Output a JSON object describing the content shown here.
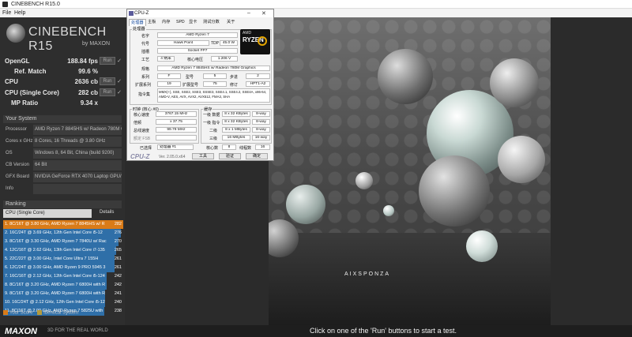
{
  "window": {
    "title": "CINEBENCH R15.0"
  },
  "menu": {
    "file": "File",
    "help": "Help"
  },
  "logo": {
    "name": "CINEBENCH R15",
    "sub": "by MAXON"
  },
  "results": [
    {
      "label": "OpenGL",
      "value": "188.84 fps",
      "run": "Run"
    },
    {
      "label": "Ref. Match",
      "value": "99.6 %",
      "run": ""
    },
    {
      "label": "CPU",
      "value": "2636 cb",
      "run": "Run"
    },
    {
      "label": "CPU (Single Core)",
      "value": "282 cb",
      "run": "Run"
    },
    {
      "label": "MP Ratio",
      "value": "9.34 x",
      "run": ""
    }
  ],
  "system": {
    "header": "Your System",
    "rows": [
      {
        "key": "Processor",
        "value": "AMD Ryzen 7 8845HS w/ Radeon 780M Graphi"
      },
      {
        "key": "Cores x GHz",
        "value": "8 Cores, 16 Threads @ 3.80 GHz"
      },
      {
        "key": "OS",
        "value": "Windows 8, 64 Bit, China (build 9200)"
      },
      {
        "key": "CB Version",
        "value": "64 Bit"
      },
      {
        "key": "GFX Board",
        "value": "NVIDIA GeForce RTX 4070 Laptop GPU/PCIe/"
      },
      {
        "key": "Info",
        "value": ""
      }
    ]
  },
  "ranking": {
    "header": "Ranking",
    "dropdown": "CPU (Single Core)",
    "details": "Details",
    "rows": [
      {
        "text": "1. 8C/16T @ 3.80 GHz, AMD Ryzen 7 8845HS w/ R",
        "score": "282",
        "fill": 1.0,
        "mine": true
      },
      {
        "text": "2. 16C/24T @ 3.69 GHz, 12th Gen Intel Core i5-12",
        "score": "276",
        "fill": 0.98,
        "mine": false
      },
      {
        "text": "3. 8C/16T @ 3.30 GHz, AMD Ryzen 7 7840U w/ Rac",
        "score": "270",
        "fill": 0.96,
        "mine": false
      },
      {
        "text": "4. 12C/16T @ 2.62 GHz, 13th Gen Intel Core i7-135",
        "score": "265",
        "fill": 0.94,
        "mine": false
      },
      {
        "text": "5. 22C/22T @ 3.00 GHz, Intel Core Ultra 7 155H",
        "score": "261",
        "fill": 0.93,
        "mine": false
      },
      {
        "text": "6. 12C/24T @ 3.00 GHz, AMD Ryzen 9 PRO 5945 3",
        "score": "261",
        "fill": 0.93,
        "mine": false
      },
      {
        "text": "7. 16C/16T @ 2.12 GHz, 12th Gen Intel Core i5-124",
        "score": "242",
        "fill": 0.86,
        "mine": false
      },
      {
        "text": "8. 8C/16T @ 3.20 GHz, AMD Ryzen 7 6800H with R",
        "score": "242",
        "fill": 0.86,
        "mine": false
      },
      {
        "text": "9. 8C/16T @ 3.20 GHz, AMD Ryzen 7 6800H with R",
        "score": "241",
        "fill": 0.85,
        "mine": false
      },
      {
        "text": "10. 16C/24T @ 2.12 GHz, 12th Gen Intel Core i5-12",
        "score": "240",
        "fill": 0.85,
        "mine": false
      },
      {
        "text": "11. 8C/16T @ 2.00 GHz, AMD Ryzen 7 5825U with",
        "score": "238",
        "fill": 0.84,
        "mine": false
      }
    ],
    "legend_mine": "Your Score",
    "legend_identical": "Identical System"
  },
  "footer": {
    "brand": "MAXON",
    "tagline": "3D FOR THE REAL WORLD",
    "message": "Click on one of the 'Run' buttons to start a test."
  },
  "scene": {
    "signature": "AIXSPONZA"
  },
  "cpuz": {
    "title": "CPU-Z",
    "tabs": [
      "处理器",
      "主板",
      "内存",
      "SPD",
      "显卡",
      "测试分数",
      "关于"
    ],
    "group_processor": "处理器",
    "name_label": "名字",
    "name_value": "AMD Ryzen 7",
    "codename_label": "代号",
    "codename_value": "Hawk Point",
    "tdp_label": "TDP",
    "tdp_value": "45.0 W",
    "package_label": "插槽",
    "package_value": "Socket FP7",
    "tech_label": "工艺",
    "tech_value": "4 纳米",
    "voltage_label": "核心电压",
    "voltage_value": "1.206 V",
    "spec_label": "规格",
    "spec_value": "AMD Ryzen 7 8845HS w/ Radeon 780M Graphics",
    "family_label": "系列",
    "family_value": "F",
    "model_label": "型号",
    "model_value": "5",
    "stepping_label": "步进",
    "stepping_value": "2",
    "extfamily_label": "扩展系列",
    "extfamily_value": "19",
    "extmodel_label": "扩展型号",
    "extmodel_value": "75",
    "revision_label": "修订",
    "revision_value": "HPT1-A2",
    "instr_label": "指令集",
    "instr_value": "MMX(+), SSE, SSE2, SSE3, SSSE3, SSE4.1, SSE4.2, SSE4A, x86-64, AMD-V, AES, AVX, AVX2, AVX512, FMA3, SHA",
    "group_clocks": "时钟 (核心 #0)",
    "corespeed_label": "核心速度",
    "corespeed_value": "3767.15 MHz",
    "multiplier_label": "倍频",
    "multiplier_value": "x 37.75",
    "bus_label": "总线速度",
    "bus_value": "99.79 MHz",
    "fsb_label": "额定 FSB",
    "fsb_value": "",
    "group_cache": "缓存",
    "l1d_label": "一级 数据",
    "l1d_value": "8 x 32 KBytes",
    "l1d_way": "8-way",
    "l1i_label": "一级 指令",
    "l1i_value": "8 x 32 KBytes",
    "l1i_way": "8-way",
    "l2_label": "二级",
    "l2_value": "8 x 1 MBytes",
    "l2_way": "8-way",
    "l3_label": "三级",
    "l3_value": "16 MBytes",
    "l3_way": "16-way",
    "selected_label": "已选择",
    "selected_value": "处理器 #1",
    "cores_label": "核心数",
    "cores_value": "8",
    "threads_label": "线程数",
    "threads_value": "16",
    "brand": "CPU-Z",
    "version": "Ver. 2.05.0.x64",
    "tools": "工具",
    "validate": "验证",
    "ok": "确定",
    "logo_amd": "AMD",
    "logo_ryzen": "RYZEN"
  }
}
